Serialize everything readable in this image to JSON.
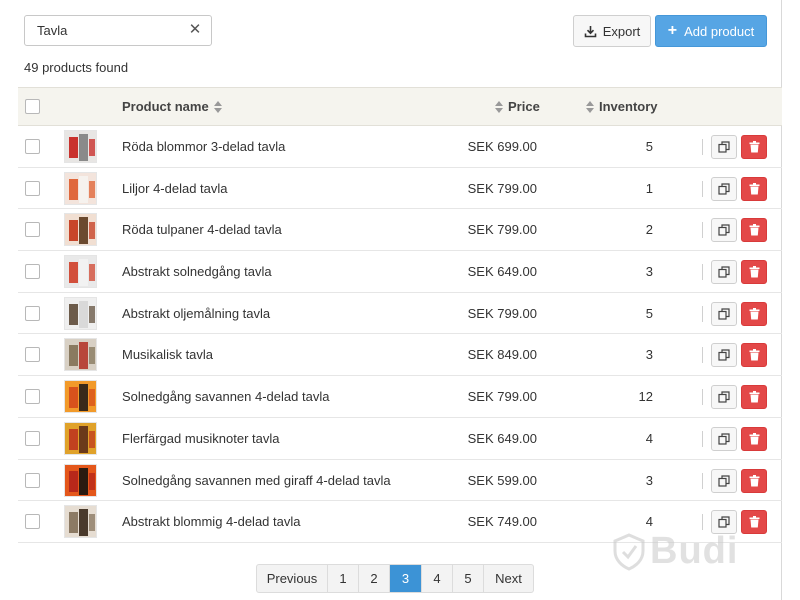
{
  "search": {
    "value": "Tavla",
    "clear_icon": "close-icon"
  },
  "toolbar": {
    "export_label": "Export",
    "add_label": "Add product"
  },
  "result_count": "49 products found",
  "columns": {
    "name": "Product name",
    "price": "Price",
    "inventory": "Inventory"
  },
  "products": [
    {
      "name": "Röda blommor 3-delad tavla",
      "price": "SEK 699.00",
      "inventory": "5",
      "thumb": [
        "#e8e6e4",
        "#c9322e",
        "#8a8a8a"
      ]
    },
    {
      "name": "Liljor 4-delad tavla",
      "price": "SEK 799.00",
      "inventory": "1",
      "thumb": [
        "#f3e4dc",
        "#e0683c",
        "#f6f2ee"
      ]
    },
    {
      "name": "Röda tulpaner 4-delad tavla",
      "price": "SEK 799.00",
      "inventory": "2",
      "thumb": [
        "#f1dfd2",
        "#c8452a",
        "#6b4a2f"
      ]
    },
    {
      "name": "Abstrakt solnedgång tavla",
      "price": "SEK 649.00",
      "inventory": "3",
      "thumb": [
        "#e9e9e9",
        "#d24f3b",
        "#f2f2f2"
      ]
    },
    {
      "name": "Abstrakt oljemålning tavla",
      "price": "SEK 799.00",
      "inventory": "5",
      "thumb": [
        "#efefef",
        "#6c5b4a",
        "#d9d9d9"
      ]
    },
    {
      "name": "Musikalisk tavla",
      "price": "SEK 849.00",
      "inventory": "3",
      "thumb": [
        "#d8d0c4",
        "#8a7a60",
        "#b8463a"
      ]
    },
    {
      "name": "Solnedgång savannen 4-delad tavla",
      "price": "SEK 799.00",
      "inventory": "12",
      "thumb": [
        "#f29a2a",
        "#d8521c",
        "#3a2a1a"
      ]
    },
    {
      "name": "Flerfärgad musiknoter tavla",
      "price": "SEK 649.00",
      "inventory": "4",
      "thumb": [
        "#e0a22a",
        "#c2411f",
        "#6b3a1a"
      ]
    },
    {
      "name": "Solnedgång savannen med giraff 4-delad tavla",
      "price": "SEK 599.00",
      "inventory": "3",
      "thumb": [
        "#e4571b",
        "#b8281a",
        "#2a1a10"
      ]
    },
    {
      "name": "Abstrakt blommig 4-delad tavla",
      "price": "SEK 749.00",
      "inventory": "4",
      "thumb": [
        "#e6ddd2",
        "#8c7a64",
        "#4a3a2c"
      ]
    }
  ],
  "pagination": {
    "previous": "Previous",
    "next": "Next",
    "pages": [
      "1",
      "2",
      "3",
      "4",
      "5"
    ],
    "current": "3"
  },
  "colors": {
    "primary": "#56a5e4",
    "danger": "#e34848",
    "header_bg": "#f5f4ee",
    "active_page": "#3c93d6"
  },
  "watermark": "Budi"
}
